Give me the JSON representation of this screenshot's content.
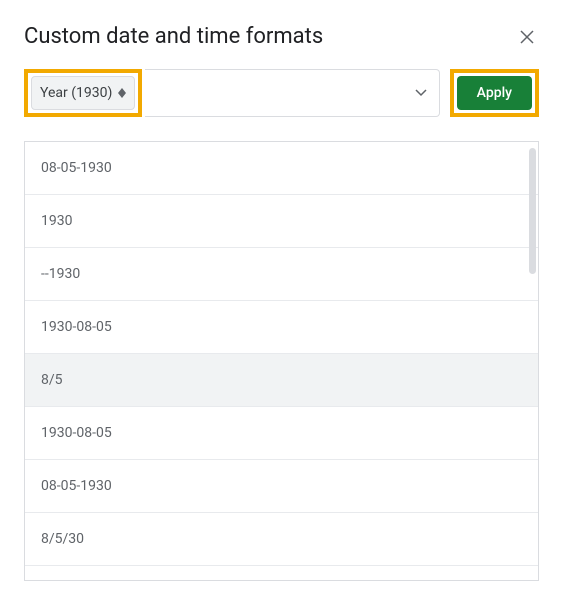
{
  "dialog": {
    "title": "Custom date and time formats"
  },
  "token": {
    "label": "Year (1930)"
  },
  "apply": {
    "label": "Apply"
  },
  "formats": [
    "08-05-1930",
    "1930",
    "--1930",
    "1930-08-05",
    "8/5",
    "1930-08-05",
    "08-05-1930",
    "8/5/30"
  ],
  "hovered_index": 4
}
